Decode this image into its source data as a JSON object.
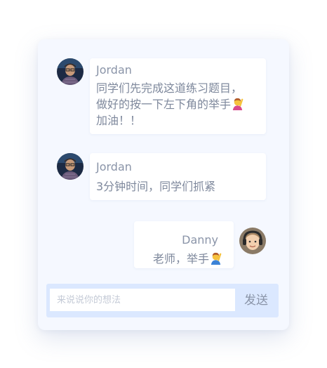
{
  "messages": [
    {
      "sender": "Jordan",
      "lines": [
        "同学们先完成这道练习题目，",
        "做好的按一下左下角的举手",
        "加油！！"
      ],
      "emoji": "person-raising-hand-emoji"
    },
    {
      "sender": "Jordan",
      "lines": [
        "3分钟时间，同学们抓紧"
      ]
    },
    {
      "sender": "Danny",
      "lines": [
        "老师，举手"
      ],
      "emoji": "person-raising-hand-emoji"
    }
  ],
  "composer": {
    "placeholder": "来说说你的想法",
    "send_label": "发送"
  },
  "colors": {
    "card_bg": "#f5f8ff",
    "input_bar_bg": "#dbe8ff",
    "text": "#8a94a8"
  }
}
